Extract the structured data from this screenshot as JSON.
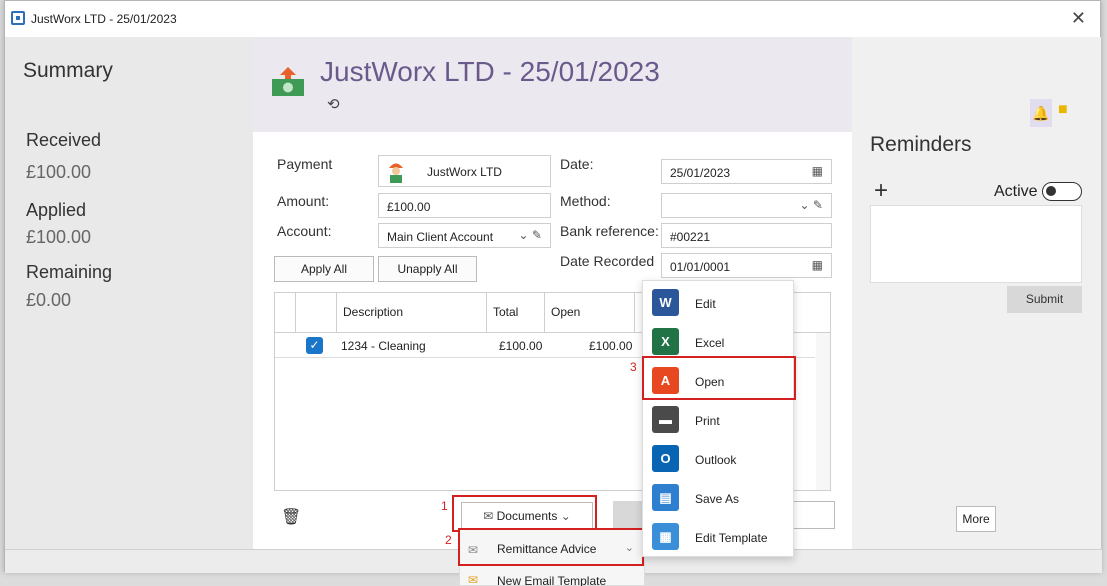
{
  "window": {
    "title": "JustWorx LTD - 25/01/2023",
    "close_glyph": "✕"
  },
  "summary": {
    "heading": "Summary",
    "received_label": "Received",
    "received_value": "£100.00",
    "applied_label": "Applied",
    "applied_value": "£100.00",
    "remaining_label": "Remaining",
    "remaining_value": "£0.00"
  },
  "header": {
    "title": "JustWorx LTD - 25/01/2023",
    "history_glyph": "⟲"
  },
  "form": {
    "payment_label": "Payment",
    "payment_value": "JustWorx LTD",
    "amount_label": "Amount:",
    "amount_value": "£100.00",
    "account_label": "Account:",
    "account_value": "Main Client Account",
    "date_label": "Date:",
    "date_value": "25/01/2023",
    "method_label": "Method:",
    "method_value": "",
    "bankref_label": "Bank reference:",
    "bankref_value": "#00221",
    "daterecorded_label": "Date Recorded",
    "daterecorded_value": "01/01/0001"
  },
  "buttons": {
    "apply_all": "Apply All",
    "unapply_all": "Unapply All",
    "documents": "Documents",
    "more": "More",
    "submit": "Submit"
  },
  "grid": {
    "columns": [
      "Description",
      "Total",
      "Open"
    ],
    "rows": [
      {
        "description": "1234 - Cleaning",
        "total": "£100.00",
        "open": "£100.00",
        "checked": true
      }
    ]
  },
  "reminders": {
    "heading": "Reminders",
    "active_label": "Active",
    "add_glyph": "+"
  },
  "document_menu": {
    "items": [
      {
        "label": "Edit",
        "icon": "word-icon",
        "glyph": "W",
        "color": "#2b579a"
      },
      {
        "label": "Excel",
        "icon": "excel-icon",
        "glyph": "X",
        "color": "#217346"
      },
      {
        "label": "Open",
        "icon": "pdf-icon",
        "glyph": "A",
        "color": "#e8481f"
      },
      {
        "label": "Print",
        "icon": "printer-icon",
        "glyph": "▬",
        "color": "#4a4a4a"
      },
      {
        "label": "Outlook",
        "icon": "outlook-icon",
        "glyph": "O",
        "color": "#0a64b4"
      },
      {
        "label": "Save As",
        "icon": "save-icon",
        "glyph": "▤",
        "color": "#2f7fd0"
      },
      {
        "label": "Edit Template",
        "icon": "template-icon",
        "glyph": "▦",
        "color": "#3a8fd8"
      }
    ]
  },
  "submenu": {
    "items": [
      "Remittance Advice",
      "New Email Template"
    ]
  },
  "annotations": {
    "one": "1",
    "two": "2",
    "three": "3"
  },
  "colors": {
    "accent": "#6a5a8c",
    "highlight": "#d32020",
    "checkbox": "#1976c8"
  }
}
